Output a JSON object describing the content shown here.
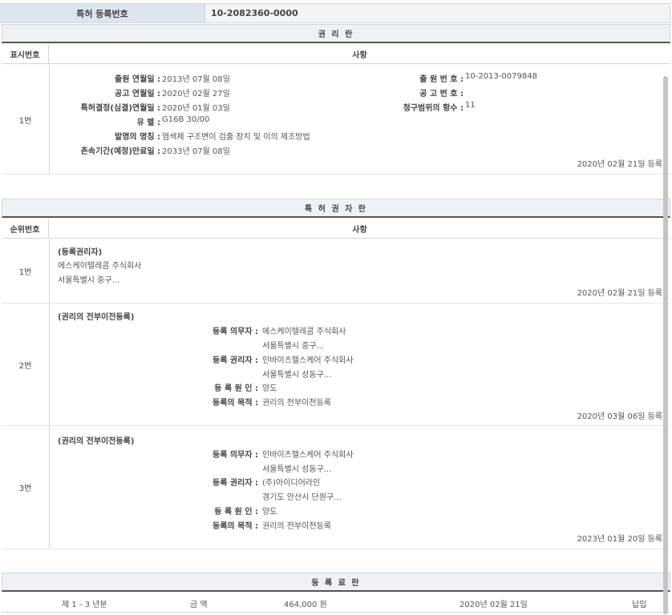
{
  "header": {
    "label": "특허 등록번호",
    "value": "10-2082360-0000"
  },
  "rights": {
    "title": "권 리 란",
    "col_num": "표시번호",
    "col_detail": "사항",
    "row1": {
      "num": "1번",
      "app_date_label": "출원 연월일 :",
      "app_date": "2013년 07월 08일",
      "app_no_label": "출 원 번 호 :",
      "app_no": "10-2013-0079848",
      "pub_date_label": "공고 연월일 :",
      "pub_date": "2020년 02월 27일",
      "pub_no_label": "공 고 번 호 :",
      "pub_no": "",
      "decision_label": "특허결정(심결)연월일 :",
      "decision_date": "2020년 01월 03일",
      "claims_label": "청구범위의 항수 :",
      "claims": "11",
      "class_label": "유 별 :",
      "class": "G16B 30/00",
      "invention_label": "발명의 명칭 :",
      "invention": "염색체 구조변이 검출 장치 및 이의 제조방법",
      "expiry_label": "존속기간(예정)만료일 :",
      "expiry": "2033년 07월 08일",
      "reg": "2020년 02월 21일 등록"
    }
  },
  "holders": {
    "title": "특 허 권 자 란",
    "col_num": "순위번호",
    "col_detail": "사항",
    "row1": {
      "num": "1번",
      "heading": "(등록권리자)",
      "name": "에스케이텔레콤 주식회사",
      "addr": "서울특별시 중구...",
      "reg": "2020년 02월 21일 등록"
    },
    "row2": {
      "num": "2번",
      "heading": "(권리의 전부이전등록)",
      "obligor_label": "등록 의무자 :",
      "obligor": "에스케이텔레콤 주식회사",
      "obligor_addr": "서울특별시 중구...",
      "holder_label": "등록 권리자 :",
      "holder": "인바이츠헬스케어 주식회사",
      "holder_addr": "서울특별시 성동구...",
      "cause_label": "등 록 원 인 :",
      "cause": "양도",
      "purpose_label": "등록의 목적 :",
      "purpose": "권리의 전부이전등록",
      "reg": "2020년 03월 06일 등록"
    },
    "row3": {
      "num": "3번",
      "heading": "(권리의 전부이전등록)",
      "obligor_label": "등록 의무자 :",
      "obligor": "인바이츠헬스케어 주식회사",
      "obligor_addr": "서울특별시 성동구...",
      "holder_label": "등록 권리자 :",
      "holder": "(주)아이디어라인",
      "holder_addr": "경기도 안산시 단원구...",
      "cause_label": "등 록 원 인 :",
      "cause": "양도",
      "purpose_label": "등록의 목적 :",
      "purpose": "권리의 전부이전등록",
      "reg": "2023년 01월 20일 등록"
    }
  },
  "fees": {
    "title": "등 록 료 란",
    "period": "제 1 - 3 년분",
    "amount_label": "금 액",
    "amount": "464,000 원",
    "date": "2020년 02월 21일",
    "status": "납입"
  }
}
